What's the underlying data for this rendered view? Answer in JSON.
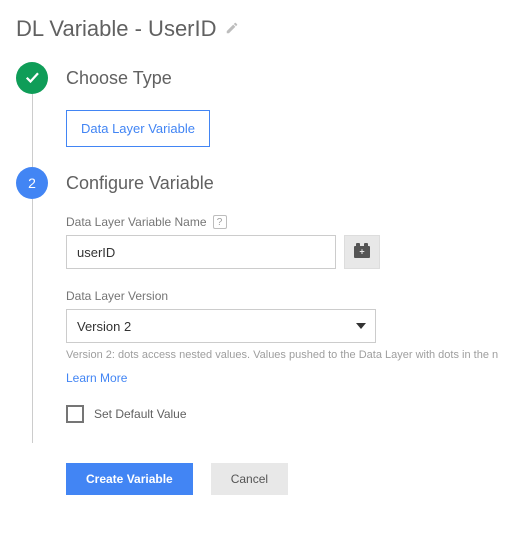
{
  "page": {
    "title": "DL Variable - UserID"
  },
  "step1": {
    "title": "Choose Type",
    "type_box": "Data Layer Variable"
  },
  "step2": {
    "number": "2",
    "title": "Configure Variable",
    "name_label": "Data Layer Variable Name",
    "name_value": "userID",
    "version_label": "Data Layer Version",
    "version_value": "Version 2",
    "version_hint": "Version 2: dots access nested values. Values pushed to the Data Layer with dots in the n",
    "learn_more": "Learn More",
    "default_label": "Set Default Value"
  },
  "buttons": {
    "create": "Create Variable",
    "cancel": "Cancel"
  }
}
